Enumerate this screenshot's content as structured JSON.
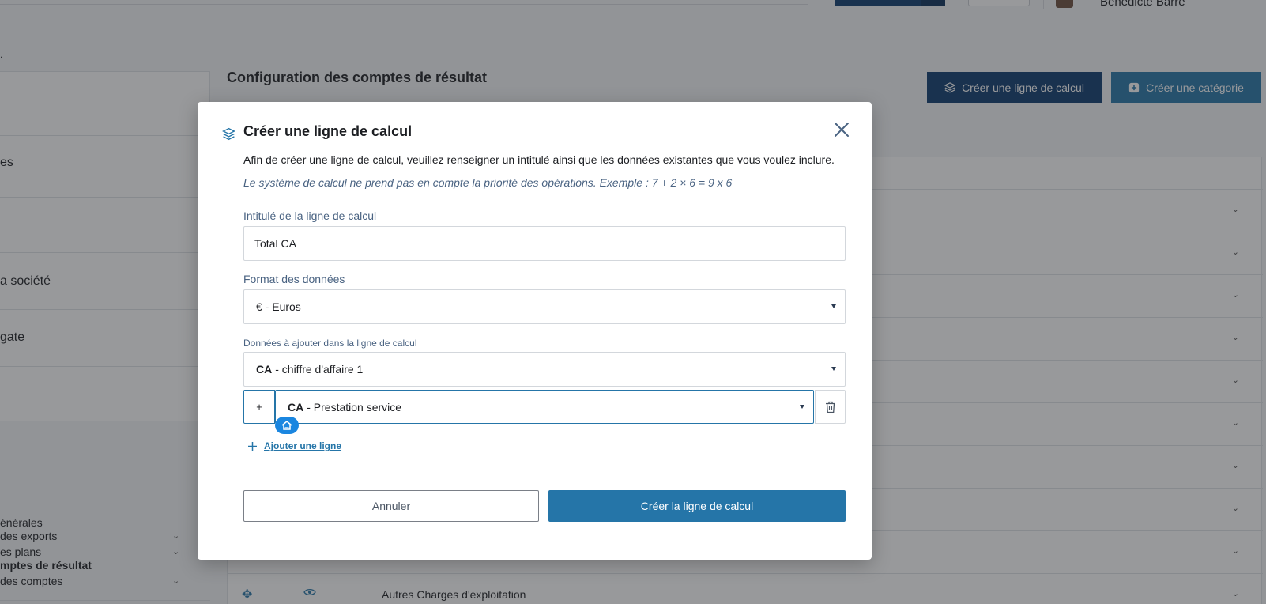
{
  "topbar": {
    "user_name": "Bénédicte Barré"
  },
  "breadcrumb": {
    "dot": "."
  },
  "sidebar": {
    "items": [
      {
        "label": "es"
      },
      {
        "label": "a société"
      },
      {
        "label": "gate"
      }
    ],
    "subitems": [
      {
        "label": "énérales"
      },
      {
        "label": "es plans"
      },
      {
        "label": "des comptes"
      },
      {
        "label": "des exports"
      },
      {
        "label": "mptes de résultat"
      }
    ]
  },
  "page": {
    "title": "Configuration des comptes de résultat",
    "create_calc_button": "Créer une ligne de calcul",
    "create_category_button": "Créer une catégorie"
  },
  "table": {
    "last_row_label": "Autres Charges d'exploitation"
  },
  "modal": {
    "title": "Créer une ligne de calcul",
    "description": "Afin de créer une ligne de calcul, veuillez renseigner un intitulé ainsi que les données existantes que vous voulez inclure.",
    "note": "Le système de calcul ne prend pas en compte la priorité des opérations. Exemple : 7 + 2 × 6 = 9 x 6",
    "label_field": {
      "label": "Intitulé de la ligne de calcul",
      "value": "Total CA"
    },
    "format_field": {
      "label": "Format des données",
      "value": "€ - Euros"
    },
    "data_field": {
      "label": "Données à ajouter dans la ligne de calcul",
      "first": {
        "code": "CA",
        "name": "- chiffre d'affaire 1"
      },
      "second": {
        "operator": "+",
        "code": "CA",
        "name": "- Prestation service"
      }
    },
    "add_line": "Ajouter une ligne",
    "cancel_button": "Annuler",
    "submit_button": "Créer la ligne de calcul"
  },
  "colors": {
    "primary": "#2575a8",
    "primary_dark": "#0c3a6d",
    "badge": "#1a86e0"
  }
}
